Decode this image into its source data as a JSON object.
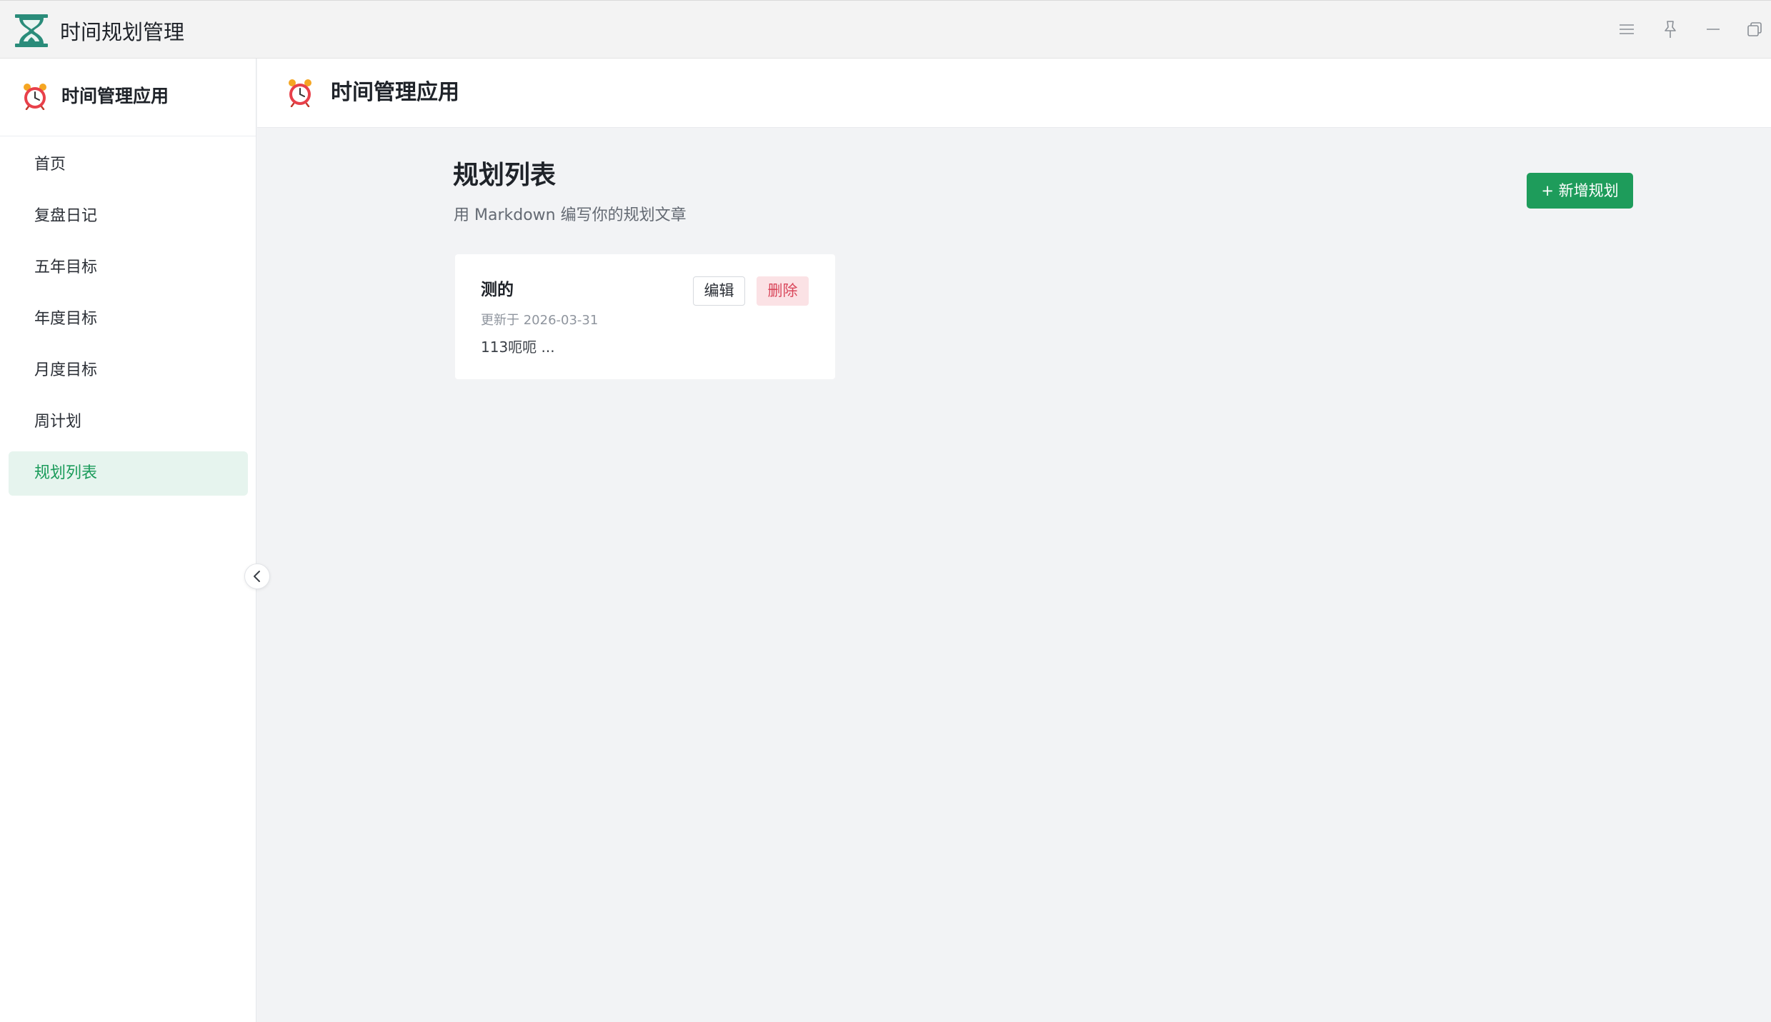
{
  "window": {
    "title": "时间规划管理",
    "controls": [
      "menu-icon",
      "pin-icon",
      "minimize-icon",
      "restore-icon"
    ]
  },
  "sidebar": {
    "brand_title": "时间管理应用",
    "items": [
      {
        "label": "首页",
        "active": false
      },
      {
        "label": "复盘日记",
        "active": false
      },
      {
        "label": "五年目标",
        "active": false
      },
      {
        "label": "年度目标",
        "active": false
      },
      {
        "label": "月度目标",
        "active": false
      },
      {
        "label": "周计划",
        "active": false
      },
      {
        "label": "规划列表",
        "active": true
      }
    ]
  },
  "header": {
    "title": "时间管理应用"
  },
  "main": {
    "title": "规划列表",
    "subtitle": "用 Markdown 编写你的规划文章",
    "add_button_label": "+ 新增规划",
    "plans": [
      {
        "title": "测的",
        "updated": "更新于 2026-03-31",
        "excerpt": "113呃呃 ...",
        "edit_label": "编辑",
        "delete_label": "删除"
      }
    ]
  },
  "colors": {
    "accent": "#1e9c5b",
    "active_nav_bg": "#e6f4ee",
    "danger_text": "#d9465a",
    "danger_bg": "#fbe2e5",
    "logo": "#2a8c7a",
    "page_bg": "#f2f3f5"
  }
}
